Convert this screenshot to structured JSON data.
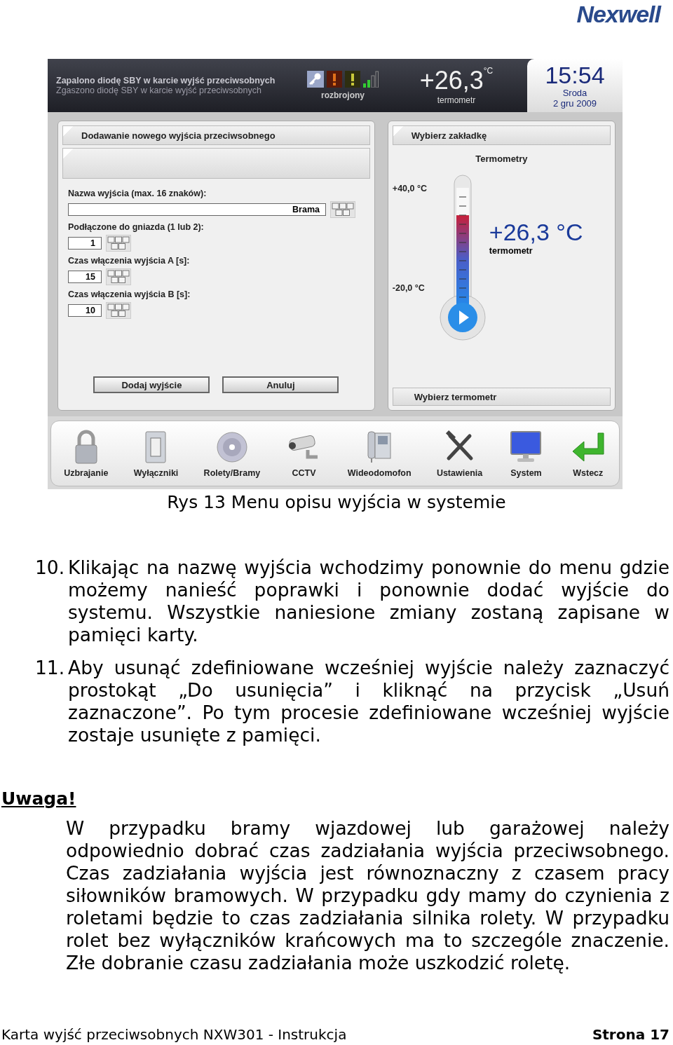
{
  "logo": "Nexwell",
  "screen": {
    "status_bar": {
      "messages": [
        {
          "text": "Zapalono diodę SBY w karcie wyjść przeciwsobnych",
          "kind": "active"
        },
        {
          "text": "Zgaszono diodę SBY w karcie wyjść przeciwsobnych",
          "kind": "past"
        }
      ],
      "alarm_state": "rozbrojony",
      "temperature": "+26,3",
      "temperature_unit": "°C",
      "temperature_label": "termometr",
      "time": "15:54",
      "day": "Sroda",
      "date": "2 gru 2009"
    },
    "form_panel": {
      "title": "Dodawanie nowego wyjścia przeciwsobnego",
      "fields": [
        {
          "label": "Nazwa wyjścia (max. 16 znaków):",
          "value": "Brama",
          "kind": "wide"
        },
        {
          "label": "Podłączone do gniazda (1 lub 2):",
          "value": "1",
          "kind": "short"
        },
        {
          "label": "Czas włączenia wyjścia A [s]:",
          "value": "15",
          "kind": "short"
        },
        {
          "label": "Czas włączenia wyjścia B [s]:",
          "value": "10",
          "kind": "short"
        }
      ],
      "buttons": [
        "Dodaj wyjście",
        "Anuluj"
      ]
    },
    "thermo_panel": {
      "title": "Wybierz zakładkę",
      "tab": "Termometry",
      "max": "+40,0 °C",
      "min": "-20,0 °C",
      "level": 0.77,
      "reading": "+26,3 °C",
      "sensor": "termometr",
      "footer": "Wybierz termometr"
    },
    "toolbar": [
      {
        "label": "Uzbrajanie",
        "kind": "lock"
      },
      {
        "label": "Wyłączniki",
        "kind": "switch"
      },
      {
        "label": "Rolety/Bramy",
        "kind": "shutter"
      },
      {
        "label": "CCTV",
        "kind": "camera"
      },
      {
        "label": "Wideodomofon",
        "kind": "intercom"
      },
      {
        "label": "Ustawienia",
        "kind": "tools"
      },
      {
        "label": "System",
        "kind": "monitor"
      },
      {
        "label": "Wstecz",
        "kind": "back"
      }
    ]
  },
  "caption": "Rys 13 Menu opisu wyjścia w systemie",
  "steps": [
    {
      "number": "10.",
      "text": "Klikając na nazwę wyjścia wchodzimy ponownie do menu gdzie możemy nanieść poprawki i ponownie dodać wyjście do systemu. Wszystkie naniesione zmiany zostaną zapisane w pamięci karty."
    },
    {
      "number": "11.",
      "text": "Aby usunąć zdefiniowane wcześniej wyjście należy zaznaczyć prostokąt „Do usunięcia” i kliknąć na przycisk „Usuń zaznaczone”. Po tym procesie zdefiniowane wcześniej wyjście zostaje usunięte z pamięci."
    }
  ],
  "note": {
    "heading": "Uwaga!",
    "text": "W przypadku bramy wjazdowej lub garażowej należy odpowiednio dobrać czas zadziałania wyjścia przeciwsobnego. Czas zadziałania wyjścia jest równoznaczny z czasem pracy siłowników bramowych. W przypadku gdy mamy do czynienia z roletami będzie to czas zadziałania silnika rolety. W przypadku rolet bez wyłączników krańcowych ma to szczególe znaczenie. Złe dobranie czasu zadziałania może uszkodzić roletę."
  },
  "footer": {
    "document": "Karta wyjść przeciwsobnych  NXW301 - Instrukcja",
    "page": "Strona 17"
  }
}
